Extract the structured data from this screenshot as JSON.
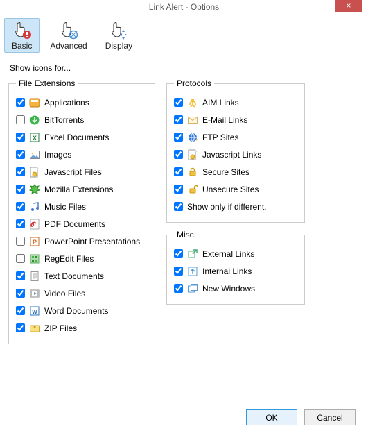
{
  "window": {
    "title": "Link Alert - Options",
    "close_symbol": "×"
  },
  "toolbar": {
    "items": [
      {
        "label": "Basic",
        "selected": true,
        "variant": "alert"
      },
      {
        "label": "Advanced",
        "selected": false,
        "variant": "click"
      },
      {
        "label": "Display",
        "selected": false,
        "variant": "scroll"
      }
    ]
  },
  "heading": "Show icons for...",
  "groups": {
    "file_extensions": {
      "legend": "File Extensions",
      "items": [
        {
          "label": "Applications",
          "checked": true,
          "icon": "app"
        },
        {
          "label": "BitTorrents",
          "checked": false,
          "icon": "torrent"
        },
        {
          "label": "Excel Documents",
          "checked": true,
          "icon": "excel"
        },
        {
          "label": "Images",
          "checked": true,
          "icon": "image"
        },
        {
          "label": "Javascript Files",
          "checked": true,
          "icon": "js"
        },
        {
          "label": "Mozilla Extensions",
          "checked": true,
          "icon": "mozilla"
        },
        {
          "label": "Music Files",
          "checked": true,
          "icon": "music"
        },
        {
          "label": "PDF Documents",
          "checked": true,
          "icon": "pdf"
        },
        {
          "label": "PowerPoint Presentations",
          "checked": false,
          "icon": "ppt"
        },
        {
          "label": "RegEdit Files",
          "checked": false,
          "icon": "regedit"
        },
        {
          "label": "Text Documents",
          "checked": true,
          "icon": "text"
        },
        {
          "label": "Video Files",
          "checked": true,
          "icon": "video"
        },
        {
          "label": "Word Documents",
          "checked": true,
          "icon": "word"
        },
        {
          "label": "ZIP Files",
          "checked": true,
          "icon": "zip"
        }
      ]
    },
    "protocols": {
      "legend": "Protocols",
      "items": [
        {
          "label": "AIM Links",
          "checked": true,
          "icon": "aim"
        },
        {
          "label": "E-Mail Links",
          "checked": true,
          "icon": "email"
        },
        {
          "label": "FTP Sites",
          "checked": true,
          "icon": "ftp"
        },
        {
          "label": "Javascript Links",
          "checked": true,
          "icon": "js"
        },
        {
          "label": "Secure Sites",
          "checked": true,
          "icon": "lock"
        },
        {
          "label": "Unsecure Sites",
          "checked": true,
          "icon": "unlock"
        },
        {
          "label": "Show only if different.",
          "checked": true,
          "icon": null
        }
      ]
    },
    "misc": {
      "legend": "Misc.",
      "items": [
        {
          "label": "External Links",
          "checked": true,
          "icon": "external"
        },
        {
          "label": "Internal Links",
          "checked": true,
          "icon": "internal"
        },
        {
          "label": "New Windows",
          "checked": true,
          "icon": "newwin"
        }
      ]
    }
  },
  "buttons": {
    "ok": "OK",
    "cancel": "Cancel"
  }
}
